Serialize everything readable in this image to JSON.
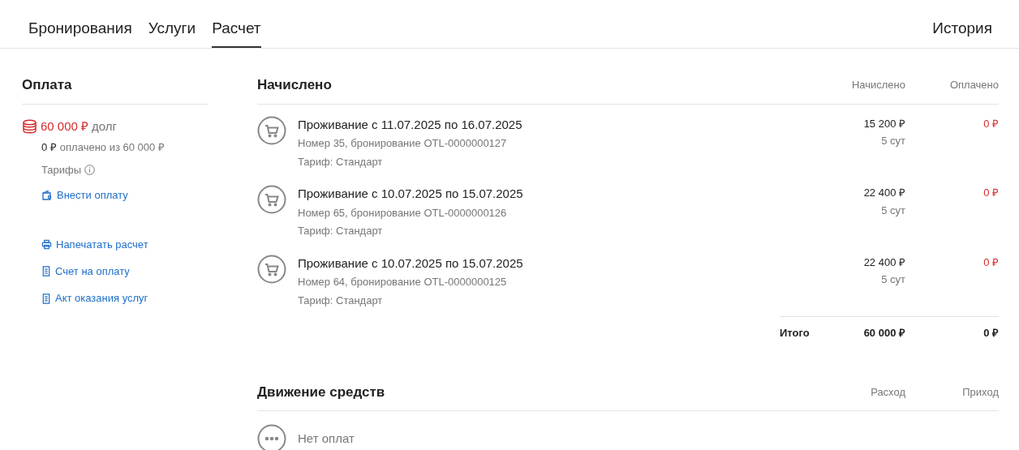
{
  "tabs": [
    {
      "label": "Бронирования",
      "selected": false
    },
    {
      "label": "Услуги",
      "selected": false
    },
    {
      "label": "Расчет",
      "selected": true
    }
  ],
  "history_tab": {
    "label": "История",
    "selected": false
  },
  "payment": {
    "title": "Оплата",
    "debt_amount": "60 000 ₽",
    "debt_label": "долг",
    "paid_amount": "0 ₽",
    "paid_text": "оплачено из 60 000 ₽",
    "tariffs": "Тарифы",
    "actions": [
      {
        "kind": "wallet",
        "label": "Внести оплату"
      }
    ],
    "documents": [
      {
        "kind": "printer",
        "label": "Напечатать расчет"
      },
      {
        "kind": "receipt",
        "label": "Счет на оплату"
      },
      {
        "kind": "receipt",
        "label": "Акт оказания услуг"
      }
    ]
  },
  "charges": {
    "title": "Начислено",
    "columns": [
      "Начислено",
      "Оплачено"
    ],
    "rows": [
      {
        "title": "Проживание с 11.07.2025 по 16.07.2025",
        "details": "Номер 35, бронирование OTL-0000000127",
        "tariff": "Тариф: Стандарт",
        "charged": "15 200 ₽",
        "duration": "5 сут",
        "paid": "0 ₽"
      },
      {
        "title": "Проживание с 10.07.2025 по 15.07.2025",
        "details": "Номер 65, бронирование OTL-0000000126",
        "tariff": "Тариф: Стандарт",
        "charged": "22 400 ₽",
        "duration": "5 сут",
        "paid": "0 ₽"
      },
      {
        "title": "Проживание с 10.07.2025 по 15.07.2025",
        "details": "Номер 64, бронирование OTL-0000000125",
        "tariff": "Тариф: Стандарт",
        "charged": "22 400 ₽",
        "duration": "5 сут",
        "paid": "0 ₽"
      }
    ],
    "total": {
      "label": "Итого",
      "charged": "60 000 ₽",
      "paid": "0 ₽"
    }
  },
  "cash_flow": {
    "title": "Движение средств",
    "columns": [
      "Расход",
      "Приход"
    ],
    "empty_text": "Нет оплат"
  }
}
